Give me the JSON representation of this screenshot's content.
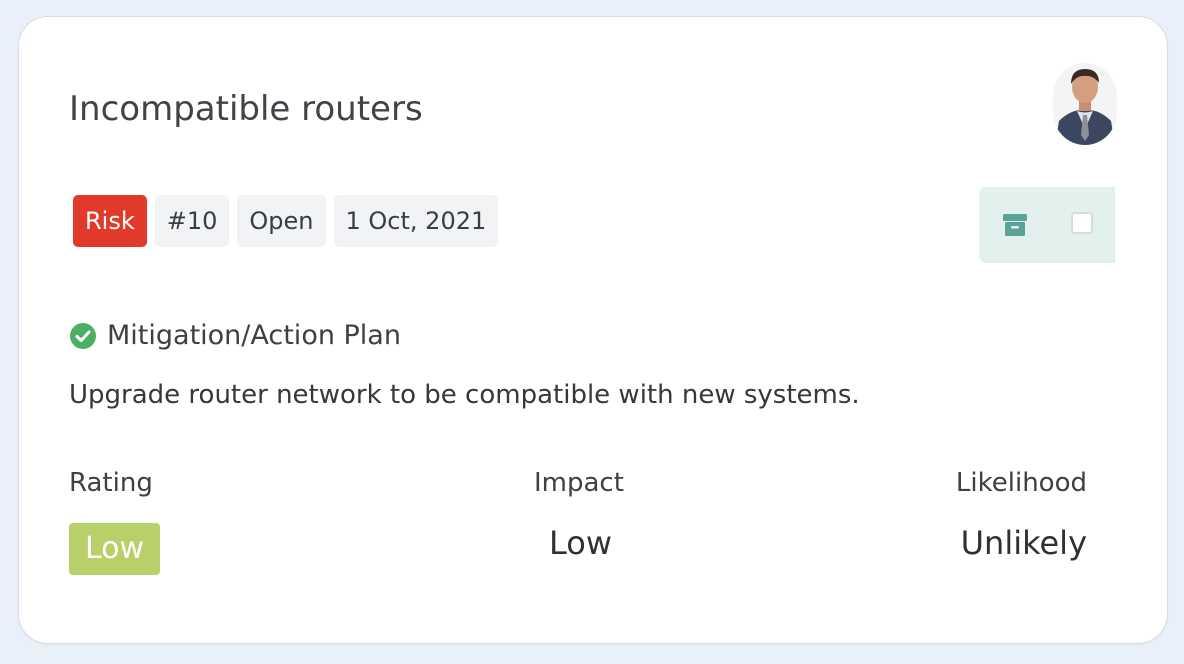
{
  "card": {
    "title": "Incompatible routers",
    "assignee_avatar": "person-avatar",
    "tags": {
      "type": "Risk",
      "number": "#10",
      "status": "Open",
      "date": "1 Oct, 2021"
    },
    "actions": {
      "archive_icon": "archive-box-icon",
      "checkbox_checked": false
    },
    "mitigation": {
      "icon": "check-circle-icon",
      "label": "Mitigation/Action Plan",
      "text": "Upgrade router network to be compatible with new systems."
    },
    "metrics": {
      "rating_label": "Rating",
      "rating_value": "Low",
      "impact_label": "Impact",
      "impact_value": "Low",
      "likelihood_label": "Likelihood",
      "likelihood_value": "Unlikely"
    }
  },
  "colors": {
    "page_background": "#e9f0fa",
    "card_background": "#ffffff",
    "risk_tag": "#e23a2a",
    "rating_low": "#b8d06a",
    "action_panel": "#e3f1ee",
    "archive_icon": "#5aa396",
    "check_icon": "#4caf64"
  }
}
